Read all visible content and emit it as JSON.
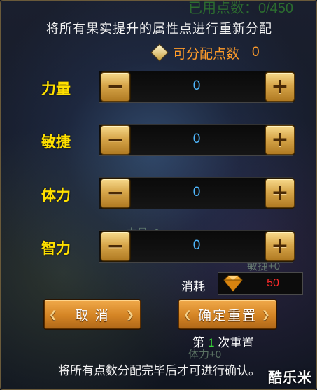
{
  "background_overlay": {
    "top_text": "已用点数：0/450",
    "ghost_power": "力量+0",
    "ghost_agility": "敏捷+0",
    "ghost_stamina": "体力+0"
  },
  "title": "将所有果实提升的属性点进行重新分配",
  "available_points": {
    "label": "可分配点数",
    "value": "0",
    "icon": "diamond-icon"
  },
  "stats": [
    {
      "label": "力量",
      "value": "0"
    },
    {
      "label": "敏捷",
      "value": "0"
    },
    {
      "label": "体力",
      "value": "0"
    },
    {
      "label": "智力",
      "value": "0"
    }
  ],
  "controls": {
    "minus_glyph": "−",
    "plus_glyph": "+"
  },
  "cost": {
    "label": "消耗",
    "value": "50",
    "icon": "diamond-gem-icon"
  },
  "buttons": {
    "cancel": "取 消",
    "confirm": "确定重置"
  },
  "reset_info": {
    "prefix": "第",
    "count": "1",
    "suffix": "次重置"
  },
  "footer_note": "将所有点数分配完毕后才可进行确认。",
  "watermark": "酷乐米",
  "colors": {
    "stat_label": "#ffe000",
    "stat_value": "#4fb8ff",
    "points": "#ff9c2a",
    "cost_value": "#ff2a2a",
    "reset_count": "#3ad83a"
  }
}
